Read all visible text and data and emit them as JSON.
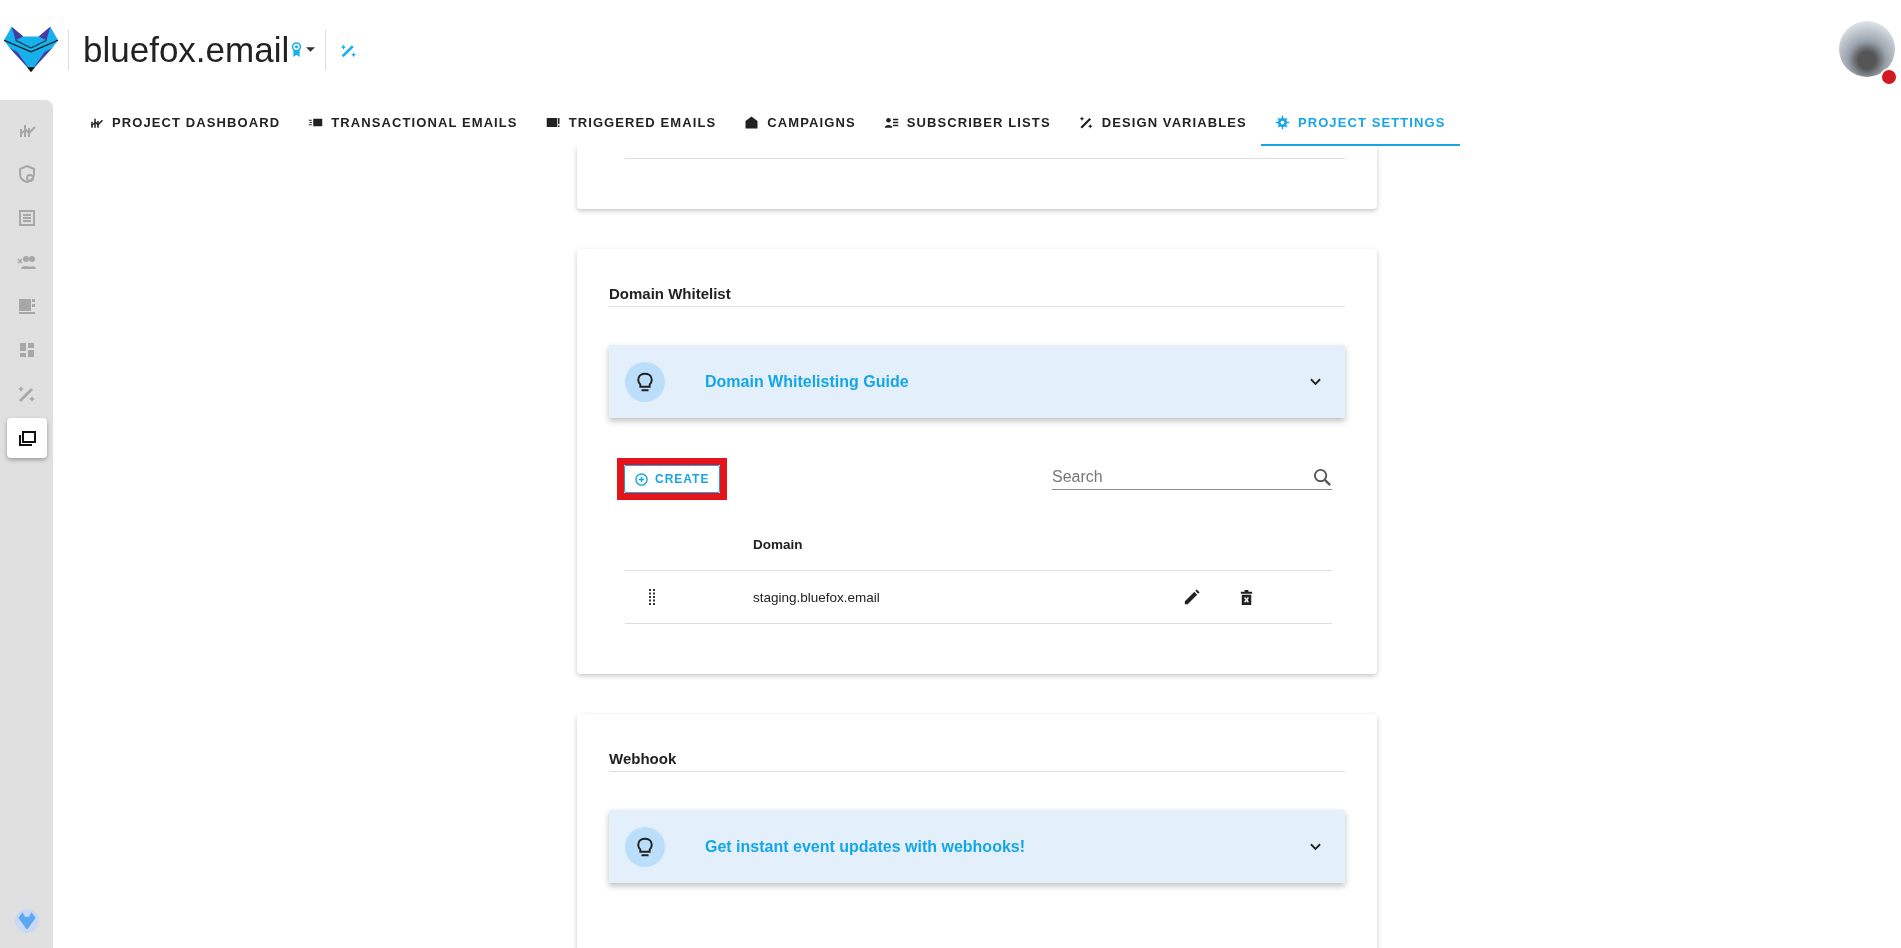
{
  "header": {
    "title": "bluefox.email"
  },
  "tabs": [
    {
      "label": "PROJECT DASHBOARD",
      "selected": false
    },
    {
      "label": "TRANSACTIONAL EMAILS",
      "selected": false
    },
    {
      "label": "TRIGGERED EMAILS",
      "selected": false
    },
    {
      "label": "CAMPAIGNS",
      "selected": false
    },
    {
      "label": "SUBSCRIBER LISTS",
      "selected": false
    },
    {
      "label": "DESIGN VARIABLES",
      "selected": false
    },
    {
      "label": "PROJECT SETTINGS",
      "selected": true
    }
  ],
  "sidebar": {
    "items": [
      {
        "selected": false
      },
      {
        "selected": false
      },
      {
        "selected": false
      },
      {
        "selected": false
      },
      {
        "selected": false
      },
      {
        "selected": false
      },
      {
        "selected": false
      },
      {
        "selected": true
      }
    ]
  },
  "domain_whitelist": {
    "title": "Domain Whitelist",
    "guide": {
      "title": "Domain Whitelisting Guide",
      "expanded": false
    },
    "create_button": "CREATE",
    "search": {
      "placeholder": "Search"
    },
    "table": {
      "columns": [
        "Domain"
      ],
      "rows": [
        {
          "domain": "staging.bluefox.email"
        }
      ]
    }
  },
  "webhook": {
    "title": "Webhook",
    "guide": {
      "title": "Get instant event updates with webhooks!",
      "expanded": false
    }
  }
}
